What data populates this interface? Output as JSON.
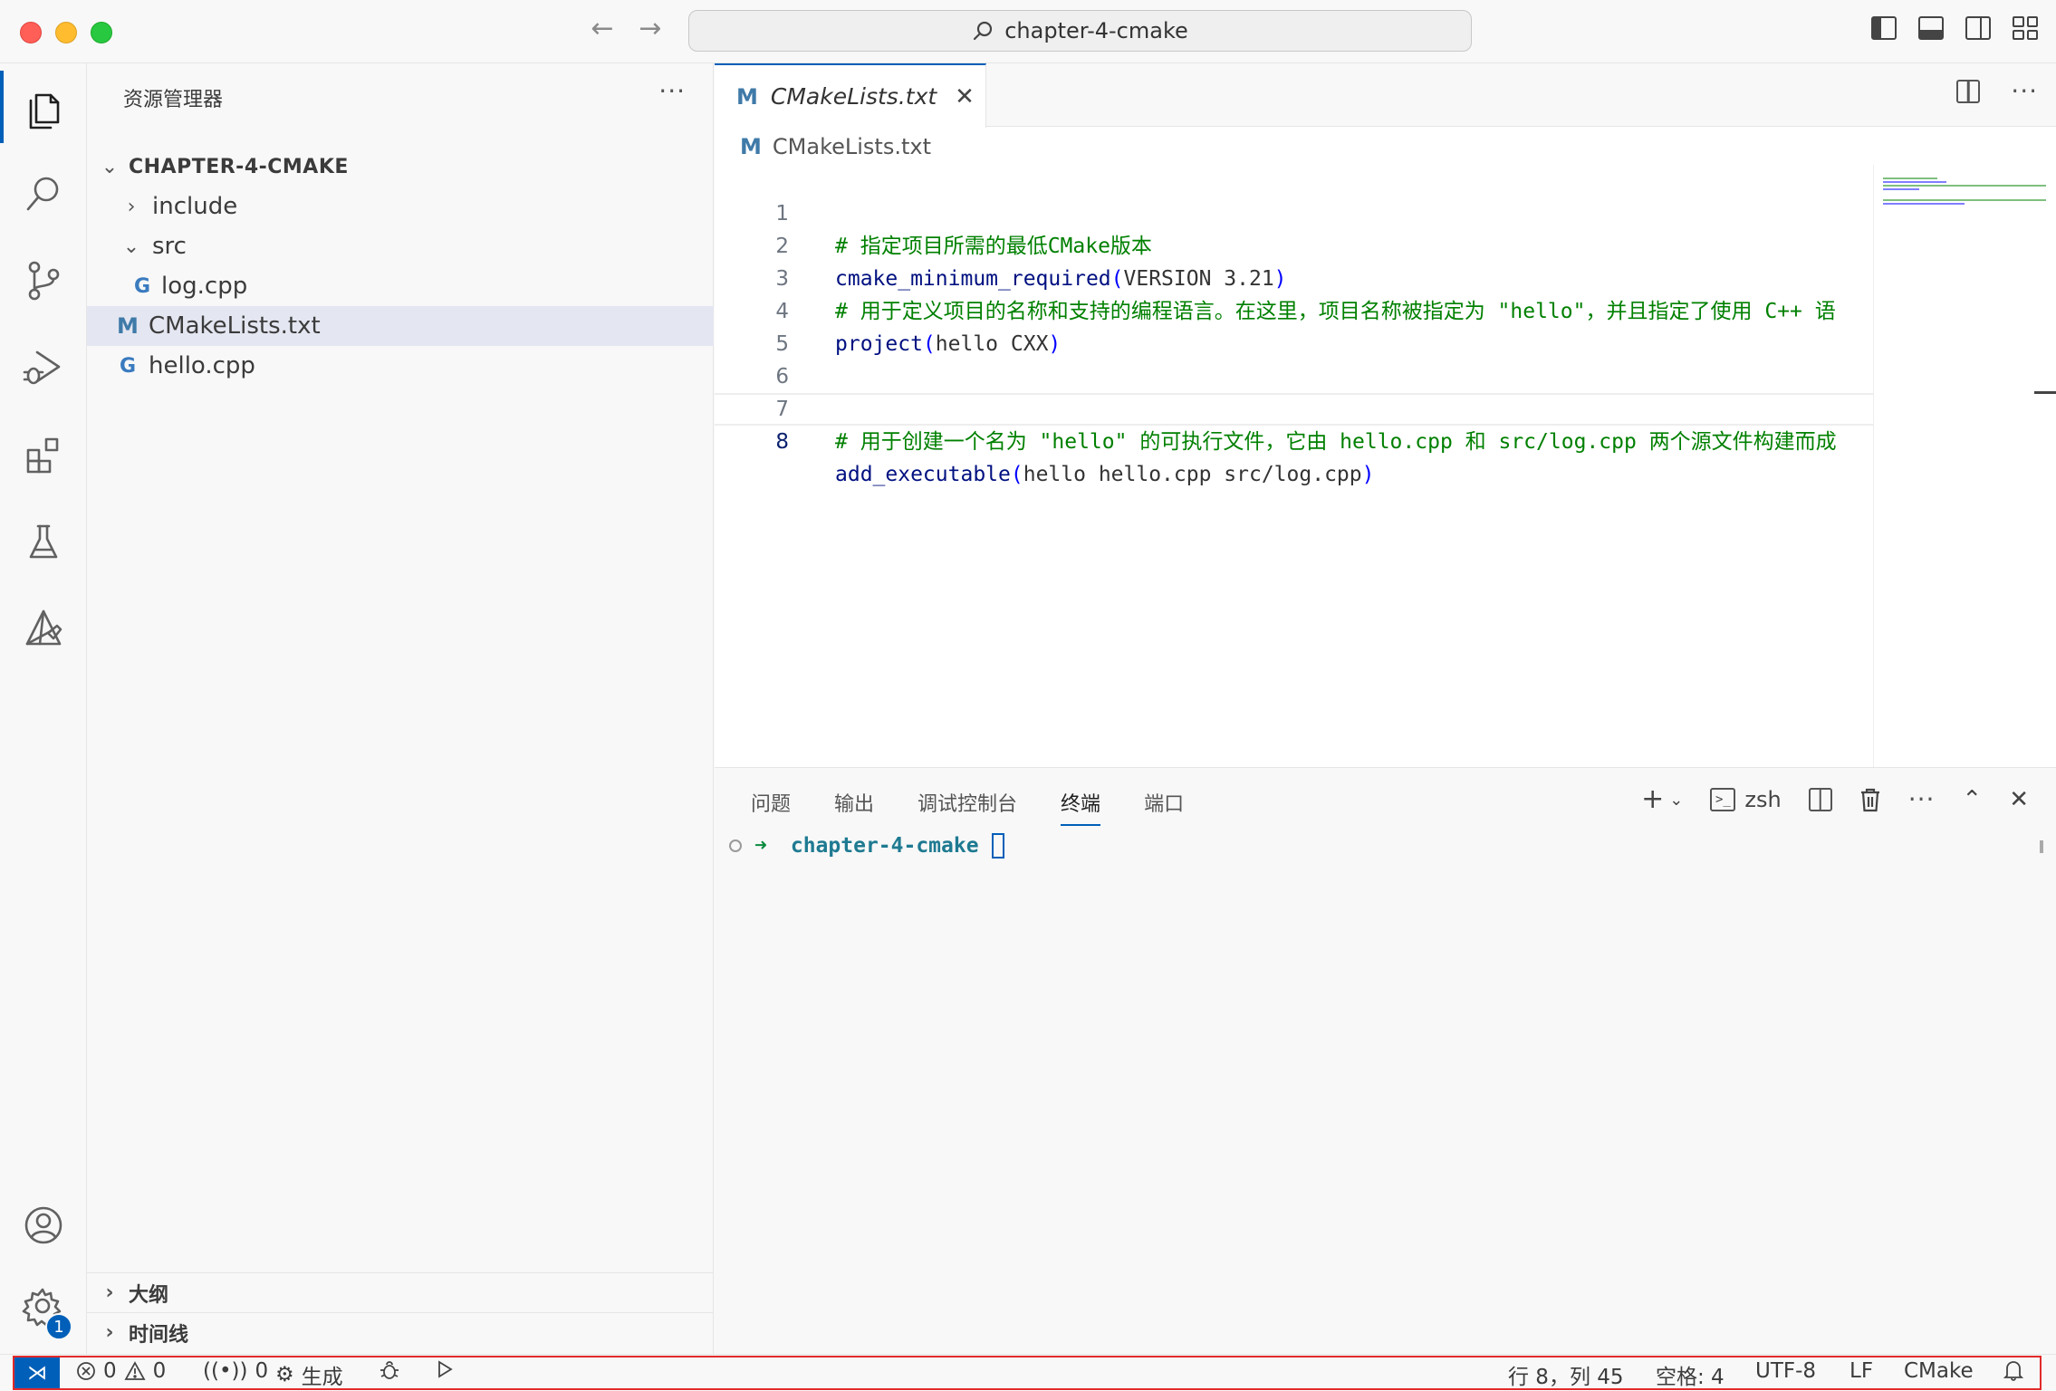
{
  "window": {
    "title": "chapter-4-cmake"
  },
  "activity_bar": {
    "items": [
      "explorer",
      "search",
      "source-control",
      "run-and-debug",
      "extensions",
      "testing",
      "cmake"
    ],
    "bottom": [
      "accounts",
      "manage"
    ],
    "manage_badge": "1"
  },
  "sidebar": {
    "title": "资源管理器",
    "root": "CHAPTER-4-CMAKE",
    "tree": {
      "include": "include",
      "src": "src",
      "log_cpp": "log.cpp",
      "cmakelists": "CMakeLists.txt",
      "hello_cpp": "hello.cpp"
    },
    "outline": "大纲",
    "timeline": "时间线"
  },
  "editor": {
    "tab_label": "CMakeLists.txt",
    "breadcrumb": "CMakeLists.txt",
    "lines": [
      {
        "num": "1",
        "comment": "# 指定项目所需的最低CMake版本"
      },
      {
        "num": "2",
        "fn": "cmake_minimum_required",
        "open": "(",
        "args": "VERSION 3.21",
        "close": ")"
      },
      {
        "num": "3",
        "comment": "# 用于定义项目的名称和支持的编程语言。在这里，项目名称被指定为 \"hello\"，并且指定了使用 C++ 语"
      },
      {
        "num": "4",
        "fn": "project",
        "open": "(",
        "args": "hello CXX",
        "close": ")"
      },
      {
        "num": "5"
      },
      {
        "num": "6"
      },
      {
        "num": "7",
        "comment": "# 用于创建一个名为 \"hello\" 的可执行文件，它由 hello.cpp 和 src/log.cpp 两个源文件构建而成"
      },
      {
        "num": "8",
        "fn": "add_executable",
        "open": "(",
        "args": "hello hello.cpp src/log.cpp",
        "close": ")"
      }
    ],
    "current_line": 8
  },
  "panel": {
    "tabs": [
      "问题",
      "输出",
      "调试控制台",
      "终端",
      "端口"
    ],
    "active_tab": "终端",
    "shell": "zsh",
    "prompt_arrow": "➜",
    "prompt_dir": "chapter-4-cmake"
  },
  "status_bar": {
    "errors": "0",
    "warnings": "0",
    "ports": "0",
    "build": "生成",
    "position": "行 8，列 45",
    "spaces": "空格: 4",
    "encoding": "UTF-8",
    "eol": "LF",
    "language": "CMake"
  },
  "colors": {
    "accent": "#005fb8",
    "comment": "#008000",
    "function": "#0000ff",
    "highlight_box": "#e22a2a"
  }
}
